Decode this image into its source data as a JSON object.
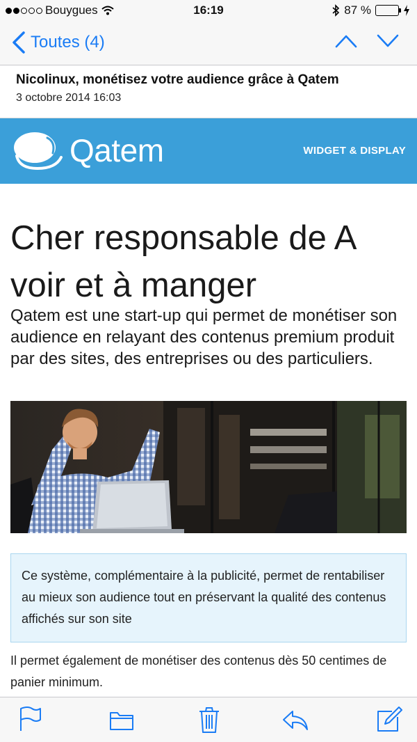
{
  "status": {
    "carrier": "Bouygues",
    "time": "16:19",
    "battery": "87 %",
    "battery_level": 0.87
  },
  "nav": {
    "back_label": "Toutes (4)"
  },
  "email": {
    "subject": "Nicolinux, monétisez votre audience grâce à Qatem",
    "date": "3 octobre 2014 16:03"
  },
  "brand": {
    "name": "Qatem",
    "tagline": "WIDGET & DISPLAY",
    "color": "#3b9fd9"
  },
  "content": {
    "headline": "Cher responsable de A voir et à manger",
    "intro": "Qatem est une start-up qui permet de monétiser son audience en relayant des contenus premium produit par des sites, des entreprises ou des particuliers.",
    "callout": "Ce système, complémentaire à la publicité, permet de rentabiliser au mieux son audience tout en préservant la qualité des contenus affichés sur son site",
    "body": "Il permet également de monétiser des contenus dès 50 centimes de panier minimum."
  },
  "accent_color": "#1a7cf5",
  "toolbar": {
    "icons": [
      "flag-icon",
      "folder-icon",
      "trash-icon",
      "reply-icon",
      "compose-icon"
    ]
  }
}
